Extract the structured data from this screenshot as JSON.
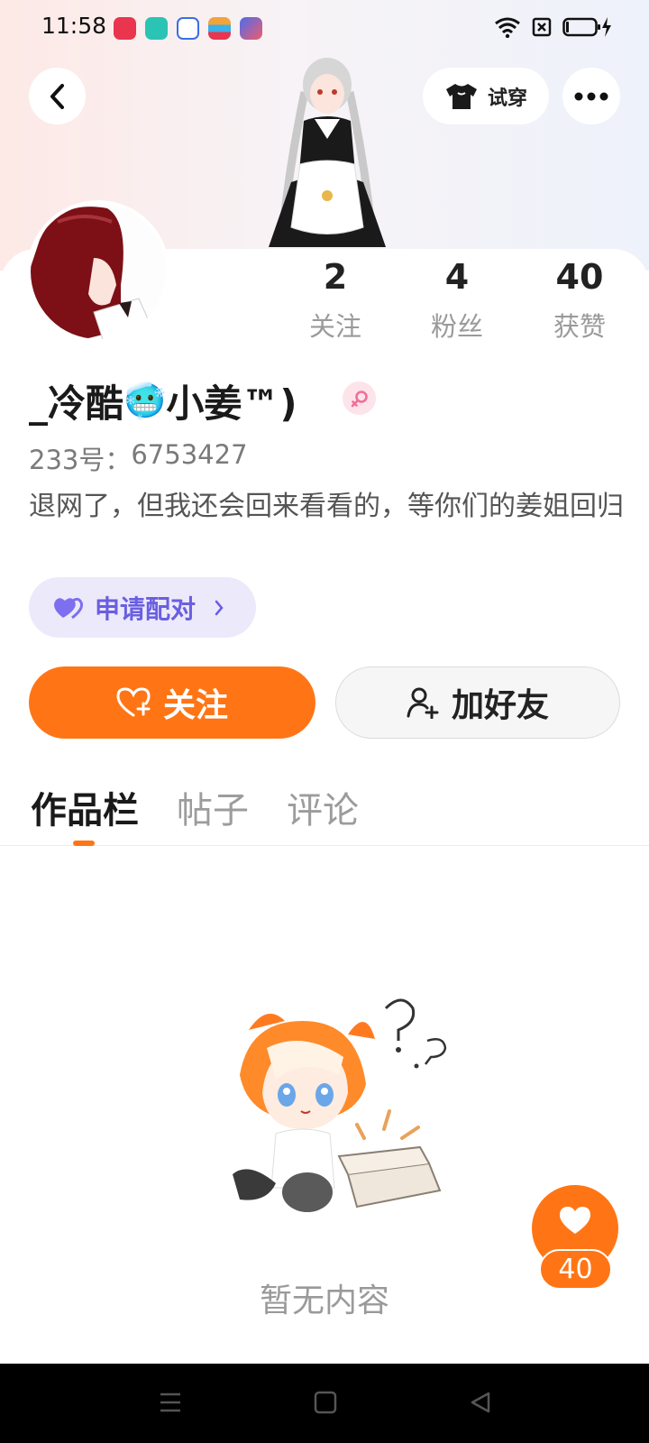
{
  "status_bar": {
    "time": "11:58",
    "app_icons": [
      {
        "name": "video-app-icon",
        "color": "#e9354e"
      },
      {
        "name": "chat-app-icon",
        "color": "#2bc3b4"
      },
      {
        "name": "baidu-icon",
        "color": "#3b6ee6"
      },
      {
        "name": "card-app-icon",
        "color": "#f2a33a"
      },
      {
        "name": "launcher-app-icon",
        "color": "#4b6cf0"
      }
    ]
  },
  "header": {
    "try_on_label": "试穿"
  },
  "profile": {
    "nickname_pre": "_冷酷",
    "nickname_emoji": "🥶",
    "nickname_post": "小姜™)",
    "uid_label": "233号：",
    "uid_value": "6753427",
    "bio": "退网了，但我还会回来看看的，等你们的姜姐回归",
    "gender": "female"
  },
  "stats": [
    {
      "value": "2",
      "label": "关注"
    },
    {
      "value": "4",
      "label": "粉丝"
    },
    {
      "value": "40",
      "label": "获赞"
    }
  ],
  "actions": {
    "pair_label": "申请配对",
    "follow_label": "关注",
    "add_friend_label": "加好友"
  },
  "tabs": [
    {
      "label": "作品栏",
      "active": true
    },
    {
      "label": "帖子",
      "active": false
    },
    {
      "label": "评论",
      "active": false
    }
  ],
  "empty_state": {
    "text": "暂无内容"
  },
  "like_fab": {
    "count": "40"
  },
  "colors": {
    "accent": "#ff7515",
    "pair_bg": "#ece9fb",
    "pair_text": "#6a5fe0"
  }
}
